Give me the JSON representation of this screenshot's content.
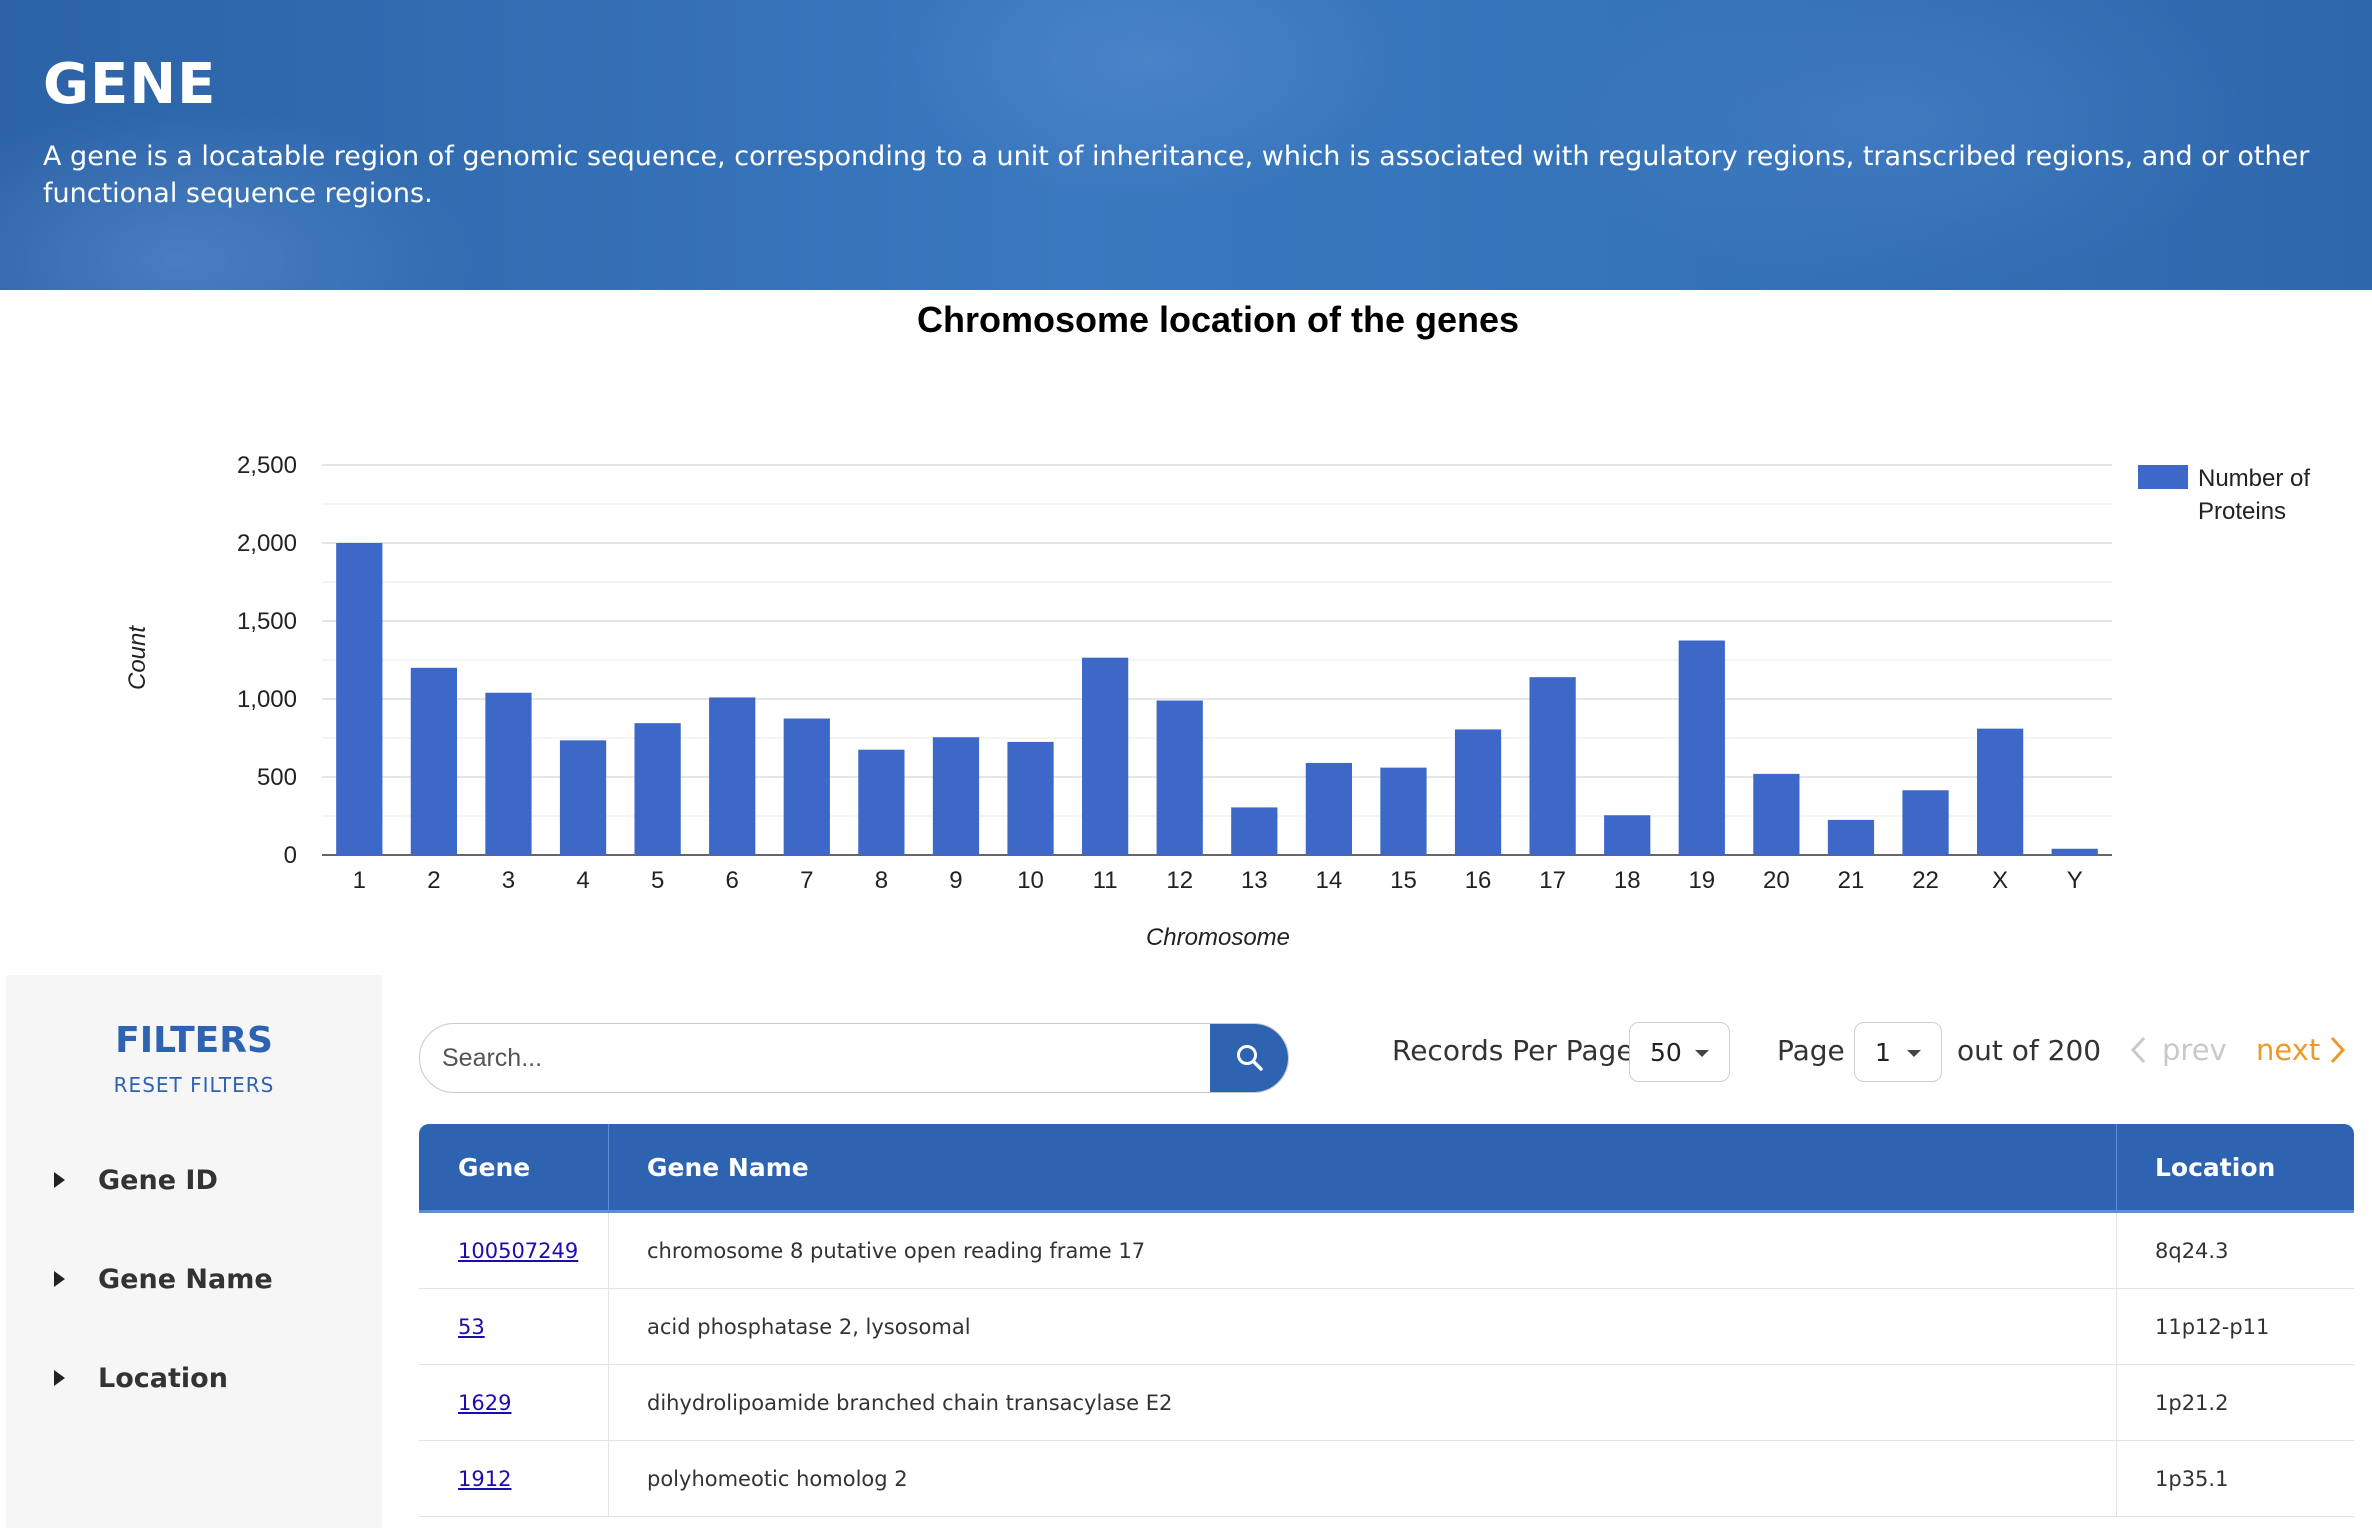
{
  "banner": {
    "title": "GENE",
    "description": "A gene is a locatable region of genomic sequence, corresponding to a unit of inheritance, which is associated with regulatory regions, transcribed regions, and or other functional sequence regions."
  },
  "chart_data": {
    "type": "bar",
    "title": "Chromosome location of the genes",
    "xlabel": "Chromosome",
    "ylabel": "Count",
    "categories": [
      "1",
      "2",
      "3",
      "4",
      "5",
      "6",
      "7",
      "8",
      "9",
      "10",
      "11",
      "12",
      "13",
      "14",
      "15",
      "16",
      "17",
      "18",
      "19",
      "20",
      "21",
      "22",
      "X",
      "Y"
    ],
    "series": [
      {
        "name": "Number of Proteins",
        "values": [
          2000,
          1200,
          1040,
          735,
          845,
          1010,
          875,
          675,
          755,
          725,
          1265,
          990,
          305,
          590,
          560,
          805,
          1140,
          255,
          1375,
          520,
          225,
          415,
          810,
          40
        ]
      }
    ],
    "ylim": [
      0,
      2500
    ],
    "yticks": [
      0,
      500,
      1000,
      1500,
      2000,
      2500
    ],
    "ytick_labels": [
      "0",
      "500",
      "1,000",
      "1,500",
      "2,000",
      "2,500"
    ],
    "grid": true,
    "legend_position": "right",
    "bar_color": "#3d68c8"
  },
  "filters": {
    "title": "FILTERS",
    "reset_label": "RESET FILTERS",
    "items": [
      {
        "label": "Gene ID"
      },
      {
        "label": "Gene Name"
      },
      {
        "label": "Location"
      }
    ]
  },
  "search": {
    "placeholder": "Search...",
    "value": ""
  },
  "pagination": {
    "records_label": "Records Per Page",
    "records_value": "50",
    "page_label": "Page",
    "page_value": "1",
    "out_of_label": "out of 200",
    "prev_label": "prev",
    "next_label": "next"
  },
  "table": {
    "headers": [
      "Gene",
      "Gene Name",
      "Location"
    ],
    "rows": [
      {
        "gene": "100507249",
        "name": "chromosome 8 putative open reading frame 17",
        "location": "8q24.3"
      },
      {
        "gene": "53",
        "name": "acid phosphatase 2, lysosomal",
        "location": "11p12-p11"
      },
      {
        "gene": "1629",
        "name": "dihydrolipoamide branched chain transacylase E2",
        "location": "1p21.2"
      },
      {
        "gene": "1912",
        "name": "polyhomeotic homolog 2",
        "location": "1p35.1"
      }
    ]
  },
  "colors": {
    "brand_blue": "#2d63b0",
    "next_orange": "#ee9a2b",
    "link_blue": "#1a0dab"
  }
}
